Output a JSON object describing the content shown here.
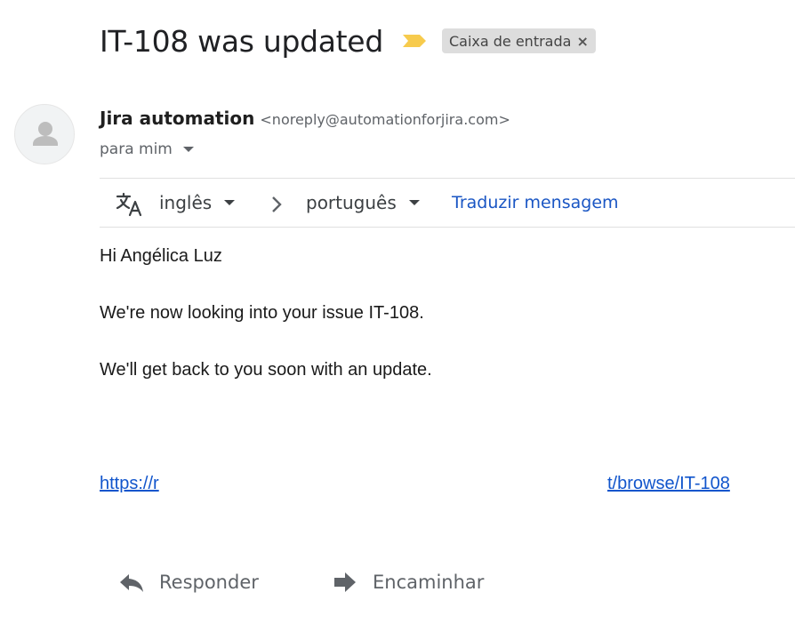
{
  "email": {
    "subject": "IT-108 was updated",
    "importance_icon": "importance-marker-icon",
    "label": {
      "text": "Caixa de entrada",
      "close": "×"
    }
  },
  "sender": {
    "avatar_icon": "person-avatar-icon",
    "name": "Jira automation",
    "email": "<noreply@automationforjira.com>",
    "recipient_label": "para mim"
  },
  "translation": {
    "icon": "translate-icon",
    "from_language": "inglês",
    "to_language": "português",
    "action": "Traduzir mensagem"
  },
  "body": {
    "greeting": "Hi Angélica Luz",
    "paragraph1": "We're now looking into your issue IT-108.",
    "paragraph2": "We'll get back to you soon with an update.",
    "link_start": "https://r",
    "link_end": "t/browse/IT-108"
  },
  "actions": {
    "reply": "Responder",
    "forward": "Encaminhar"
  },
  "colors": {
    "importance": "#f7cb4d",
    "link": "#1155cc",
    "translate_link": "#1a56c4",
    "label_bg": "#dddddd"
  }
}
